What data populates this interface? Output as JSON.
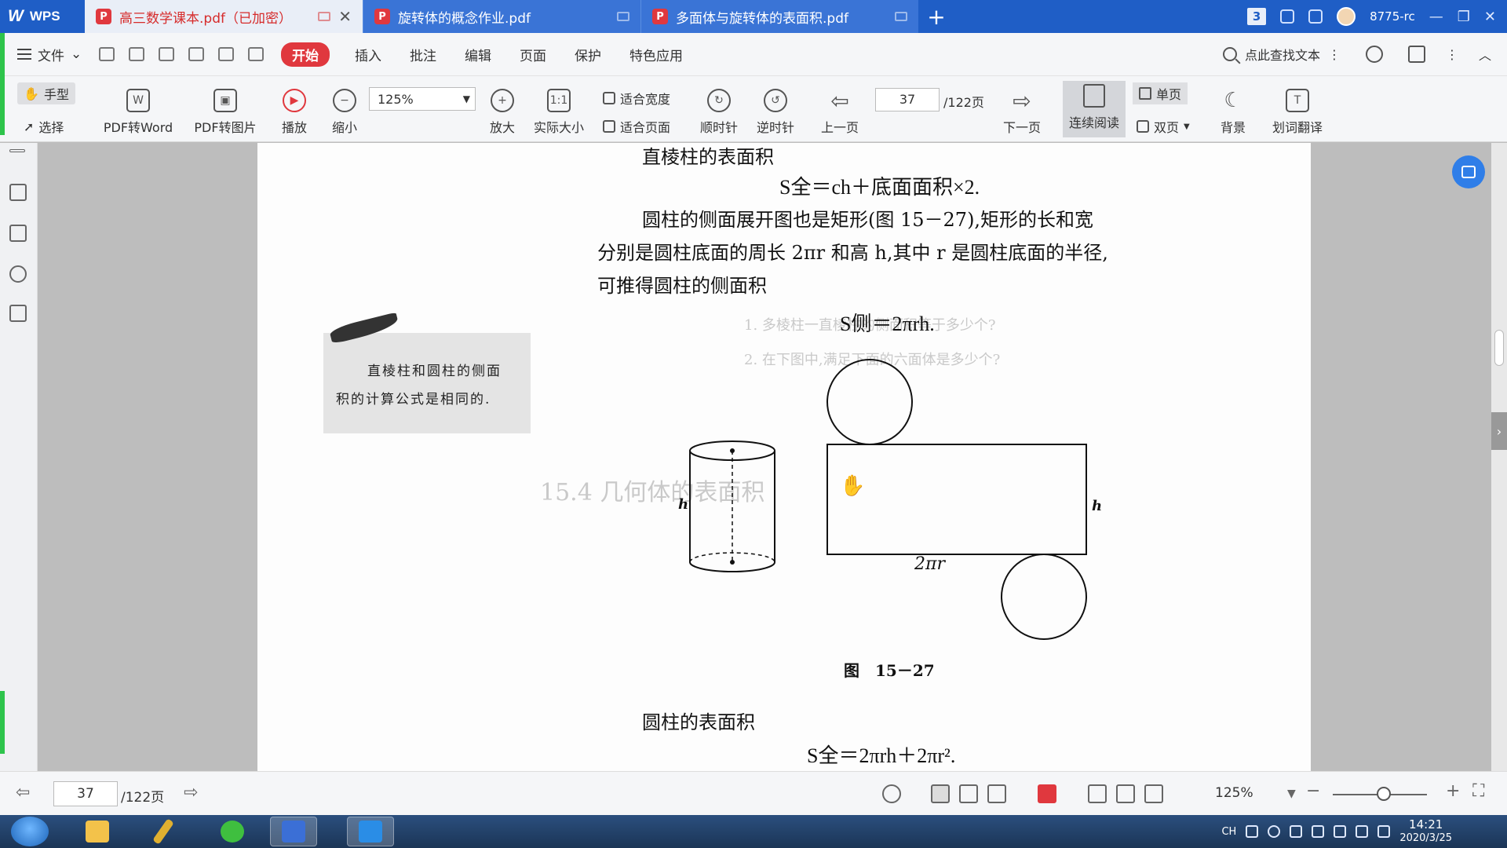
{
  "app": {
    "name": "WPS",
    "account": "8775-rc",
    "window_count": "3"
  },
  "tabs": [
    {
      "label": "高三数学课本.pdf（已加密）",
      "active": true
    },
    {
      "label": "旋转体的概念作业.pdf",
      "active": false
    },
    {
      "label": "多面体与旋转体的表面积.pdf",
      "active": false
    }
  ],
  "menu": {
    "file": "文件",
    "items": [
      "开始",
      "插入",
      "批注",
      "编辑",
      "页面",
      "保护",
      "特色应用"
    ],
    "search_placeholder": "点此查找文本"
  },
  "toolbar": {
    "hand": "手型",
    "select": "选择",
    "pdf_to_word": "PDF转Word",
    "pdf_to_image": "PDF转图片",
    "play": "播放",
    "zoom_out": "缩小",
    "zoom_value": "125%",
    "zoom_in": "放大",
    "actual_size": "实际大小",
    "fit_width": "适合宽度",
    "fit_page": "适合页面",
    "rotate_cw": "顺时针",
    "rotate_ccw": "逆时针",
    "prev_page": "上一页",
    "current_page": "37",
    "total_pages": "/122页",
    "next_page": "下一页",
    "continuous": "连续阅读",
    "single": "单页",
    "double": "双页",
    "background": "背景",
    "translate": "划词翻译"
  },
  "document": {
    "heading1": "直棱柱的表面积",
    "formula1": "S全＝ch＋底面面积×2.",
    "para_line1": "圆柱的侧面展开图也是矩形(图 15－27),矩形的长和宽",
    "para_line2": "分别是圆柱底面的周长 2πr 和高 h,其中 r 是圆柱底面的半径,",
    "para_line3": "可推得圆柱的侧面积",
    "formula2": "S侧＝2πrh.",
    "note_line1": "直棱柱和圆柱的侧面",
    "note_line2": "积的计算公式是相同的.",
    "fig_label_h_left": "h",
    "fig_label_h_right": "h",
    "fig_label_circ": "2πr",
    "fig_caption": "图　15－27",
    "heading2": "圆柱的表面积",
    "formula3": "S全＝2πrh＋2πr²."
  },
  "statusbar": {
    "current_page": "37",
    "total_pages": "/122页",
    "zoom": "125%"
  },
  "taskbar": {
    "lang": "CH",
    "time": "14:21",
    "date": "2020/3/25"
  }
}
